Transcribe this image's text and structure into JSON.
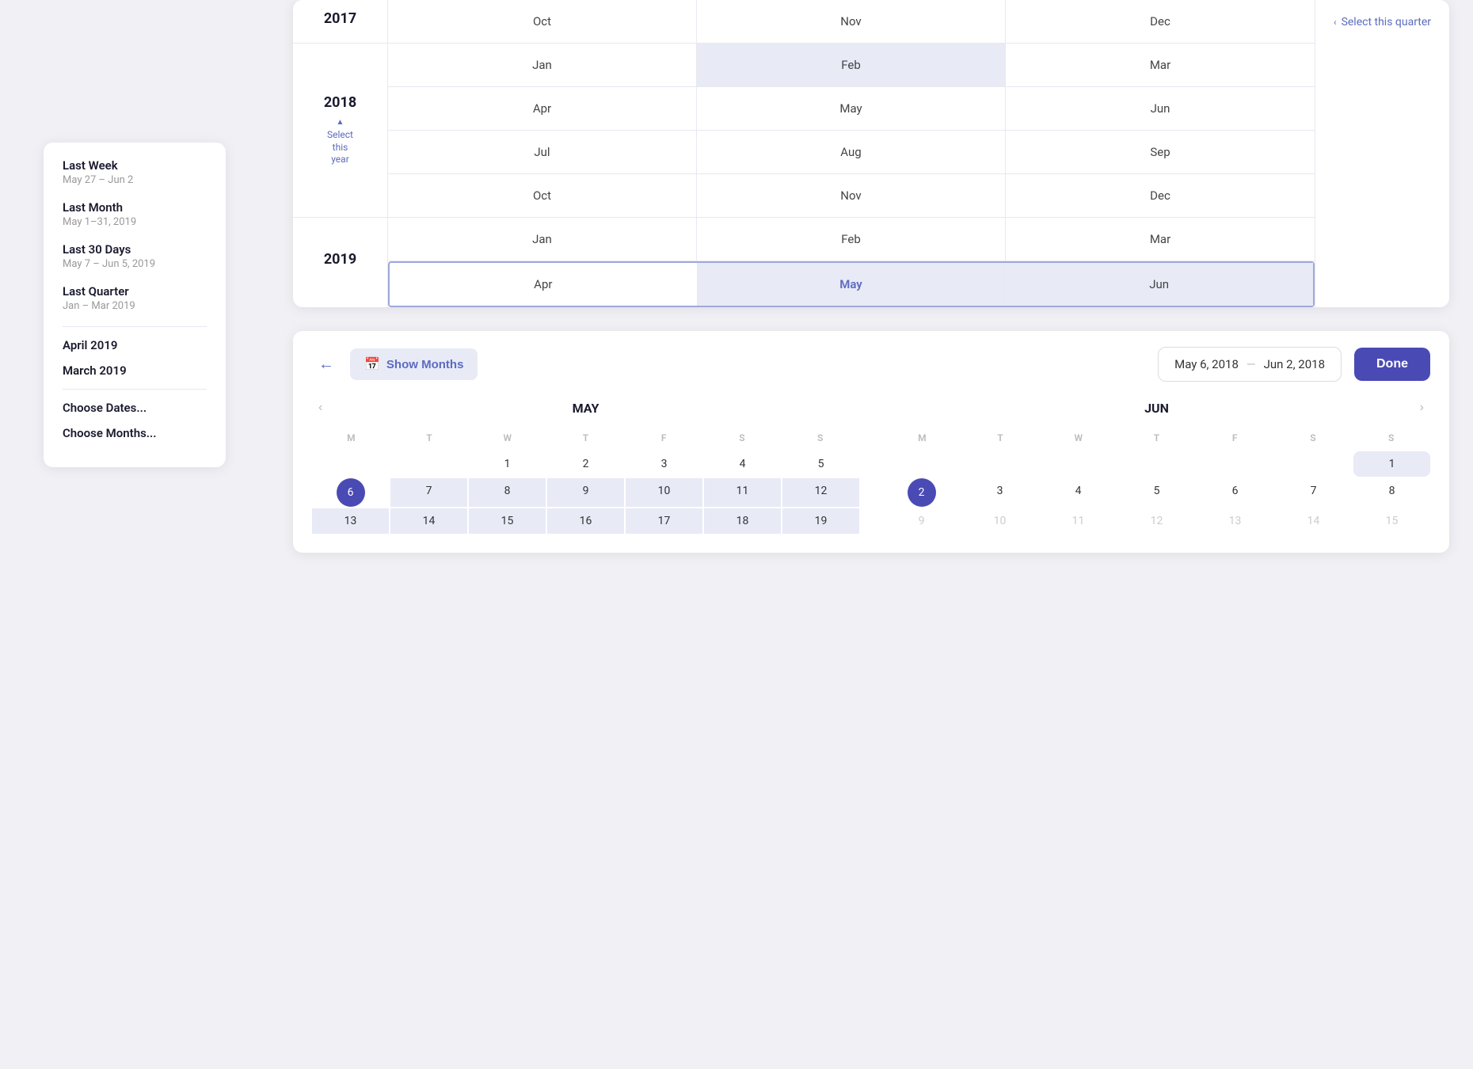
{
  "sidebar": {
    "items": [
      {
        "id": "last-week",
        "title": "Last Week",
        "sub": "May 27 – Jun 2"
      },
      {
        "id": "last-month",
        "title": "Last Month",
        "sub": "May 1–31, 2019"
      },
      {
        "id": "last-30-days",
        "title": "Last 30 Days",
        "sub": "May 7 – Jun 5, 2019"
      },
      {
        "id": "last-quarter",
        "title": "Last Quarter",
        "sub": "Jan – Mar 2019"
      }
    ],
    "months": [
      "April 2019",
      "March 2019"
    ],
    "links": [
      "Choose Dates...",
      "Choose Months..."
    ]
  },
  "monthGrid": {
    "years": [
      {
        "year": "2017",
        "rows": [
          [
            "Oct",
            "Nov",
            "Dec"
          ]
        ]
      },
      {
        "year": "2018",
        "selectYearLabel": "Select this year",
        "rows": [
          [
            "Jan",
            "Feb",
            "Mar"
          ],
          [
            "Apr",
            "May",
            "Jun"
          ],
          [
            "Jul",
            "Aug",
            "Sep"
          ],
          [
            "Oct",
            "Nov",
            "Dec"
          ]
        ],
        "highlighted": [
          "Feb"
        ],
        "selected": []
      },
      {
        "year": "2019",
        "rows": [
          [
            "Jan",
            "Feb",
            "Mar"
          ],
          [
            "Apr",
            "May",
            "Jun"
          ]
        ],
        "highlighted": [
          "May",
          "Jun"
        ],
        "borderedRow": 1
      }
    ],
    "quarterLabel": "Select this quarter"
  },
  "toolbar": {
    "backLabel": "←",
    "showMonthsLabel": "Show Months",
    "calendarIcon": "📅",
    "dateFrom": "May 6, 2018",
    "dateTo": "Jun 2, 2018",
    "doneLabel": "Done"
  },
  "calendars": [
    {
      "month": "MAY",
      "dayNames": [
        "M",
        "T",
        "W",
        "T",
        "F",
        "S",
        "S"
      ],
      "weeks": [
        [
          null,
          null,
          1,
          2,
          3,
          4,
          5
        ],
        [
          6,
          7,
          8,
          9,
          10,
          11,
          12
        ],
        [
          13,
          14,
          15,
          16,
          17,
          18,
          19
        ]
      ],
      "selectedStart": 6,
      "rangeEnd": 12,
      "showPrevNav": true,
      "showNextNav": false
    },
    {
      "month": "JUN",
      "dayNames": [
        "M",
        "T",
        "W",
        "T",
        "F",
        "S",
        "S"
      ],
      "weeks": [
        [
          null,
          null,
          null,
          null,
          null,
          null,
          1
        ],
        [
          2,
          3,
          4,
          5,
          6,
          7,
          8
        ],
        [
          9,
          10,
          11,
          12,
          13,
          14,
          15
        ]
      ],
      "selectedStart": 2,
      "rangeStart": 1,
      "showPrevNav": false,
      "showNextNav": true
    }
  ]
}
